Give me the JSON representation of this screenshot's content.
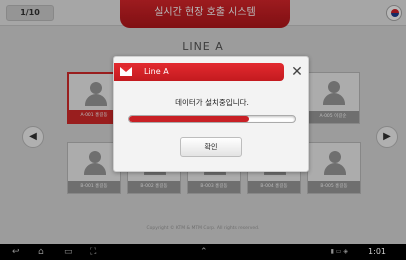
{
  "header": {
    "page_indicator": "1/10",
    "title": "실시간 현장 호출 시스템"
  },
  "line_title": "LINE A",
  "nav": {
    "left": "◀",
    "right": "▶"
  },
  "row1": [
    {
      "name": "A-001 홍길동",
      "active": true
    },
    {
      "name": "A-005 이길순",
      "active": false
    }
  ],
  "row2": [
    {
      "name": "B-001 홍길동"
    },
    {
      "name": "B-002 홍길동"
    },
    {
      "name": "B-003 홍길동"
    },
    {
      "name": "B-004 홍길동"
    },
    {
      "name": "B-005 홍길동"
    }
  ],
  "copyright": "Copyright © KTM & MTM Corp. All rights reserved.",
  "dialog": {
    "title": "Line A",
    "close": "✕",
    "message": "데이터가 설치중입니다.",
    "progress": 0.72,
    "confirm": "확인"
  },
  "sysbar": {
    "time": "1:01",
    "back": "↩",
    "home": "⌂",
    "recent": "▭",
    "screenshot": "⛶",
    "menu": "⌃"
  },
  "colors": {
    "accent": "#d42a2a"
  }
}
